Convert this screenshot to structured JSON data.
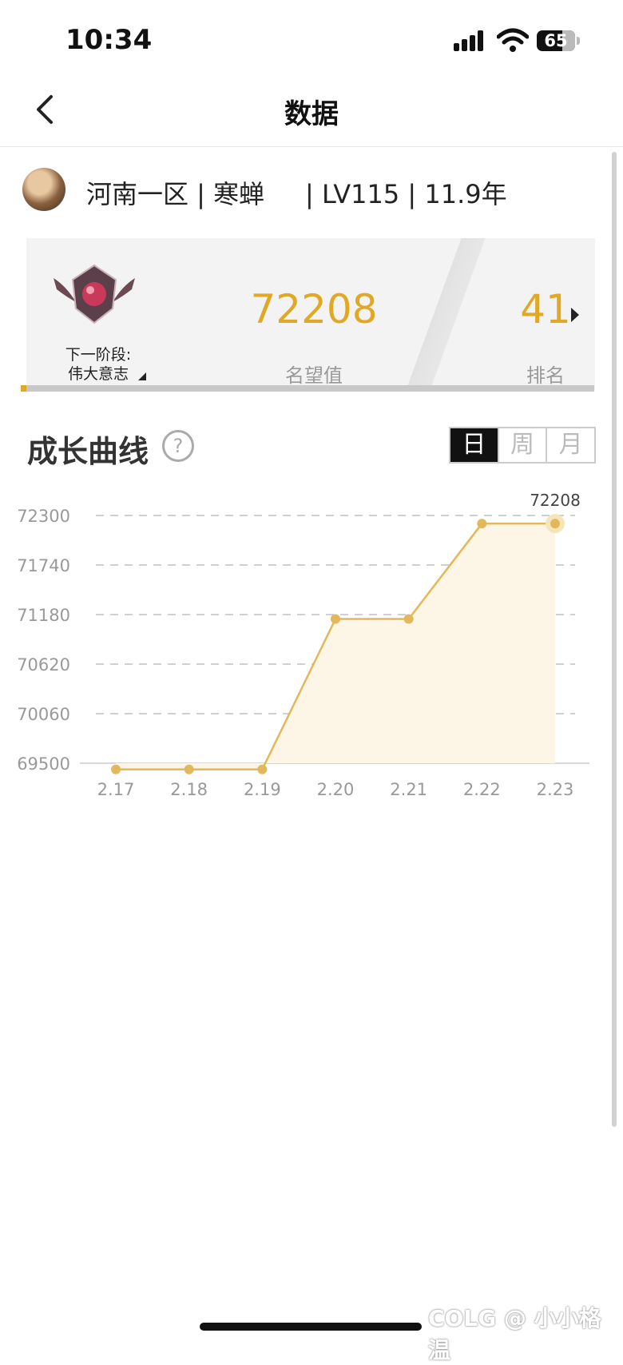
{
  "status": {
    "time": "10:34",
    "battery": "65"
  },
  "nav": {
    "title": "数据"
  },
  "profile": {
    "text": "河南一区 | 寒蝉     | LV115 | 11.9年"
  },
  "rank_card": {
    "next_label_1": "下一阶段:",
    "next_label_2": "伟大意志",
    "reputation_value": "72208",
    "reputation_label": "名望值",
    "rank_value": "41",
    "rank_label": "排名",
    "progress_fraction": 0.01
  },
  "growth": {
    "title": "成长曲线",
    "help": "?",
    "tabs": [
      "日",
      "周",
      "月"
    ],
    "active_tab": "日"
  },
  "chart_data": {
    "type": "line",
    "x": [
      "2.17",
      "2.18",
      "2.19",
      "2.20",
      "2.21",
      "2.22",
      "2.23"
    ],
    "values": [
      69430,
      69430,
      69430,
      71130,
      71130,
      72208,
      72208
    ],
    "yticks": [
      69500,
      70060,
      70620,
      71180,
      71740,
      72300
    ],
    "ylim": [
      69500,
      72300
    ],
    "highlight_label": "72208",
    "grid": true,
    "colors": {
      "line": "#e2b85a",
      "point": "#e2b85a",
      "fill": "#fdf6e6"
    }
  },
  "watermark": "COLG @ 小小格温"
}
